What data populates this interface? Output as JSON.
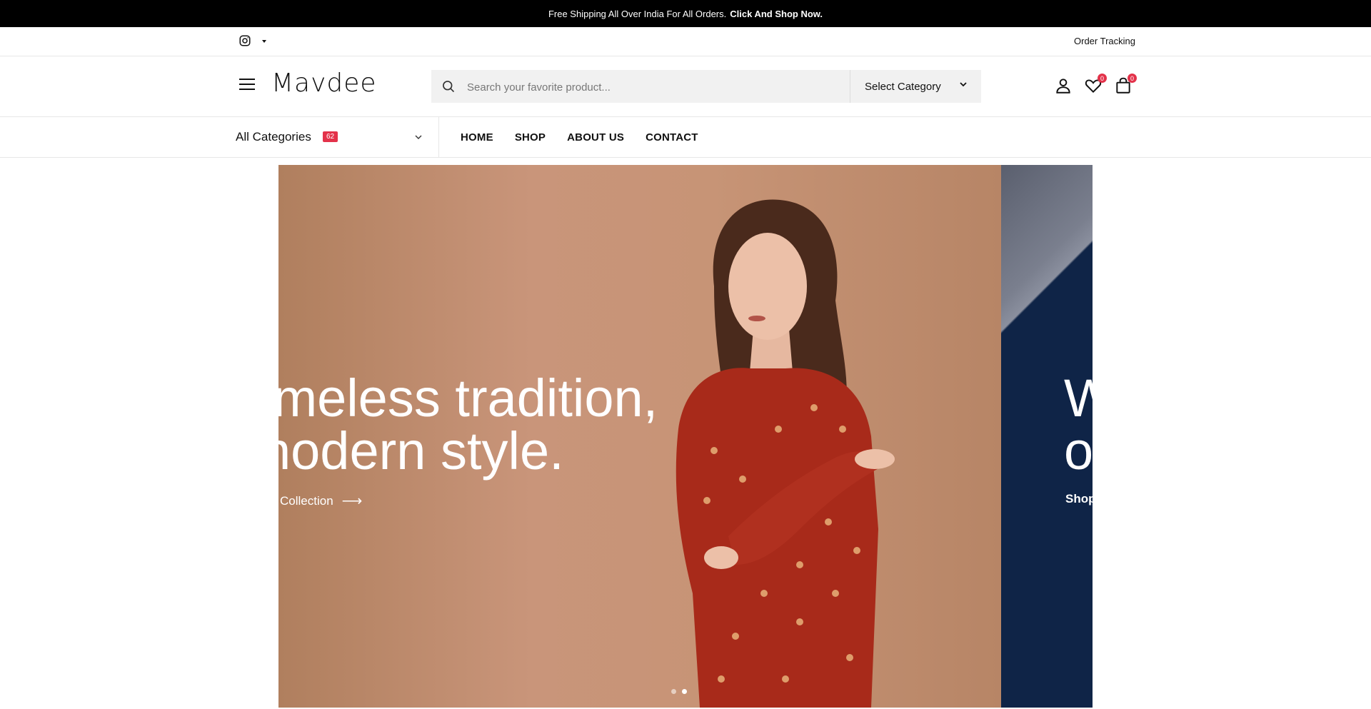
{
  "topbar": {
    "text": "Free Shipping All Over India For All Orders.",
    "link": "Click And Shop Now."
  },
  "utility": {
    "order_tracking": "Order Tracking",
    "social_icon": "instagram-icon"
  },
  "header": {
    "logo": "Mavdee",
    "search": {
      "placeholder": "Search your favorite product...",
      "category_label": "Select Category"
    },
    "wishlist_count": "0",
    "cart_count": "0"
  },
  "nav": {
    "all_categories": "All Categories",
    "category_count": "62",
    "menu": [
      "HOME",
      "SHOP",
      "ABOUT US",
      "CONTACT"
    ]
  },
  "hero": {
    "slide1": {
      "line1": "imeless tradition,",
      "line2": "nodern style.",
      "cta": "Collection",
      "background": "#c5906f"
    },
    "slide2": {
      "line1": "W",
      "line2": "o",
      "cta": "Shop",
      "background": "#0f2447"
    },
    "slide_count": 2,
    "active_slide": 1
  },
  "colors": {
    "accent": "#e3324a",
    "topbar": "#000000"
  }
}
